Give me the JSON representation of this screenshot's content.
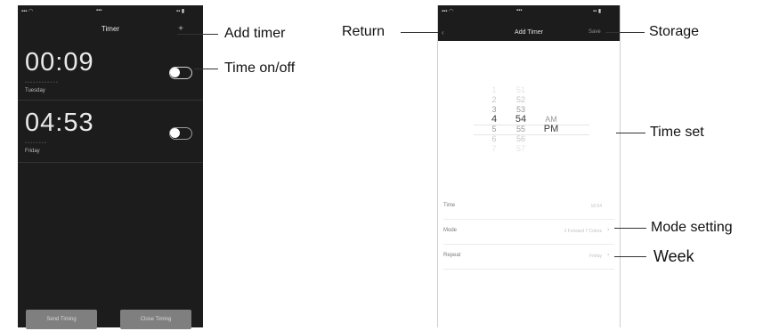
{
  "left_phone": {
    "title": "Timer",
    "add_icon": "+",
    "timers": [
      {
        "time": "00:09",
        "day": "Tuesday",
        "enabled": true
      },
      {
        "time": "04:53",
        "day": "Friday",
        "enabled": false
      }
    ],
    "buttons": {
      "send": "Send Timing",
      "close": "Close Timing"
    }
  },
  "right_phone": {
    "title": "Add Timer",
    "save_label": "Save",
    "picker": {
      "hours": [
        "1",
        "2",
        "3",
        "4",
        "5",
        "6",
        "7"
      ],
      "minutes": [
        "51",
        "52",
        "53",
        "54",
        "55",
        "56",
        "57"
      ],
      "periods": [
        "AM",
        "PM"
      ],
      "selected": {
        "hour": "4",
        "minute": "54",
        "period": "PM"
      }
    },
    "rows": [
      {
        "label": "Time",
        "value": "16:54"
      },
      {
        "label": "Mode",
        "value": "3 Forward 7 Colors"
      },
      {
        "label": "Repeat",
        "value": "Friday"
      }
    ]
  },
  "callouts": {
    "add_timer": "Add timer",
    "time_onoff": "Time on/off",
    "return": "Return",
    "storage": "Storage",
    "time_set": "Time set",
    "mode_setting": "Mode setting",
    "week": "Week"
  },
  "colors": {
    "dark_bg": "#1c1c1c",
    "button_gray": "#7f7f7f",
    "text_light": "#e9e9e9"
  }
}
